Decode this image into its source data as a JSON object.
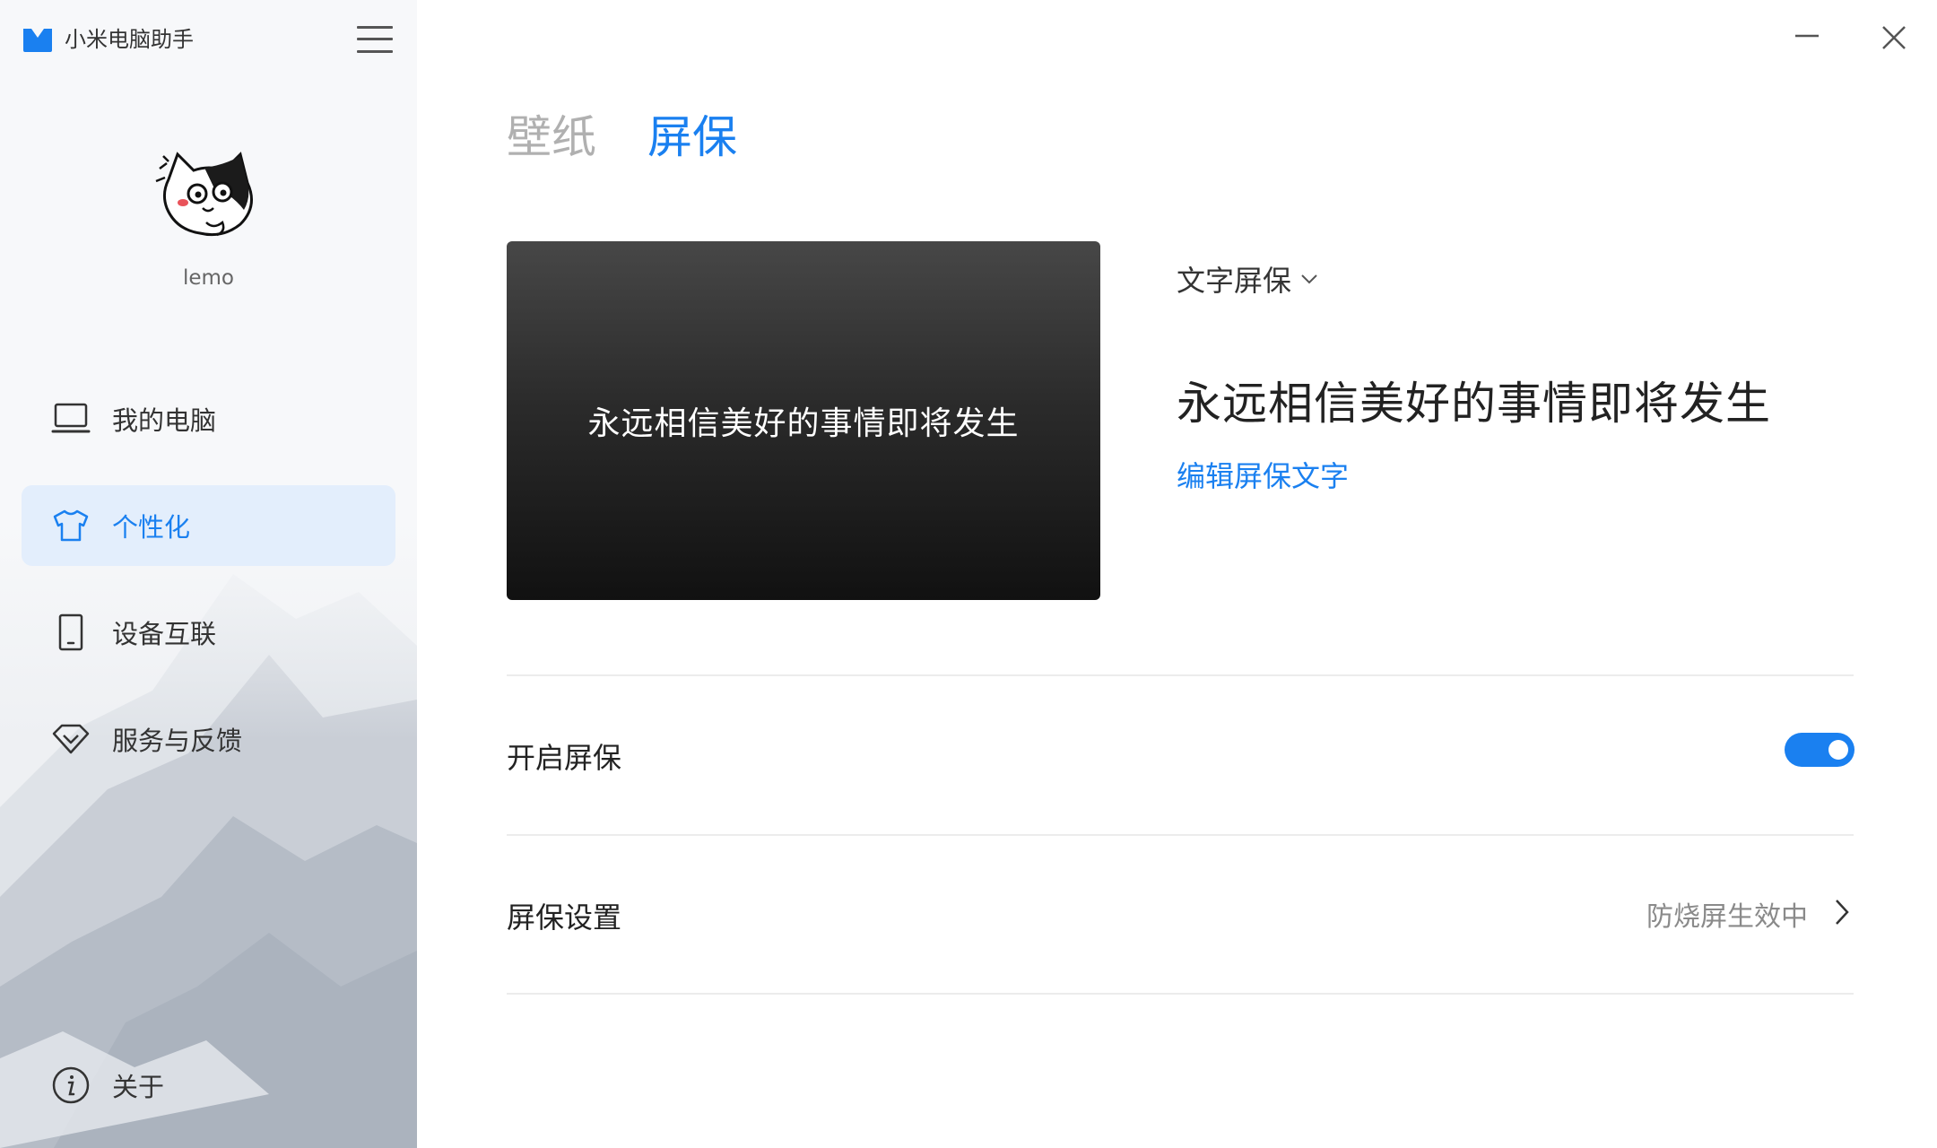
{
  "app": {
    "title": "小米电脑助手"
  },
  "user": {
    "name": "lemo"
  },
  "sidebar": {
    "items": [
      {
        "label": "我的电脑",
        "icon": "laptop-icon"
      },
      {
        "label": "个性化",
        "icon": "tshirt-icon",
        "active": true
      },
      {
        "label": "设备互联",
        "icon": "tablet-icon"
      },
      {
        "label": "服务与反馈",
        "icon": "diamond-icon"
      }
    ],
    "about": {
      "label": "关于",
      "icon": "info-icon"
    }
  },
  "tabs": [
    {
      "label": "壁纸",
      "active": false
    },
    {
      "label": "屏保",
      "active": true
    }
  ],
  "screensaver": {
    "preview_text": "永远相信美好的事情即将发生",
    "type": "文字屏保",
    "current_text": "永远相信美好的事情即将发生",
    "edit_label": "编辑屏保文字",
    "enable_label": "开启屏保",
    "enabled": true,
    "settings_label": "屏保设置",
    "settings_status": "防烧屏生效中"
  },
  "colors": {
    "accent": "#1a80f0",
    "active_bg": "#e3eefc"
  }
}
